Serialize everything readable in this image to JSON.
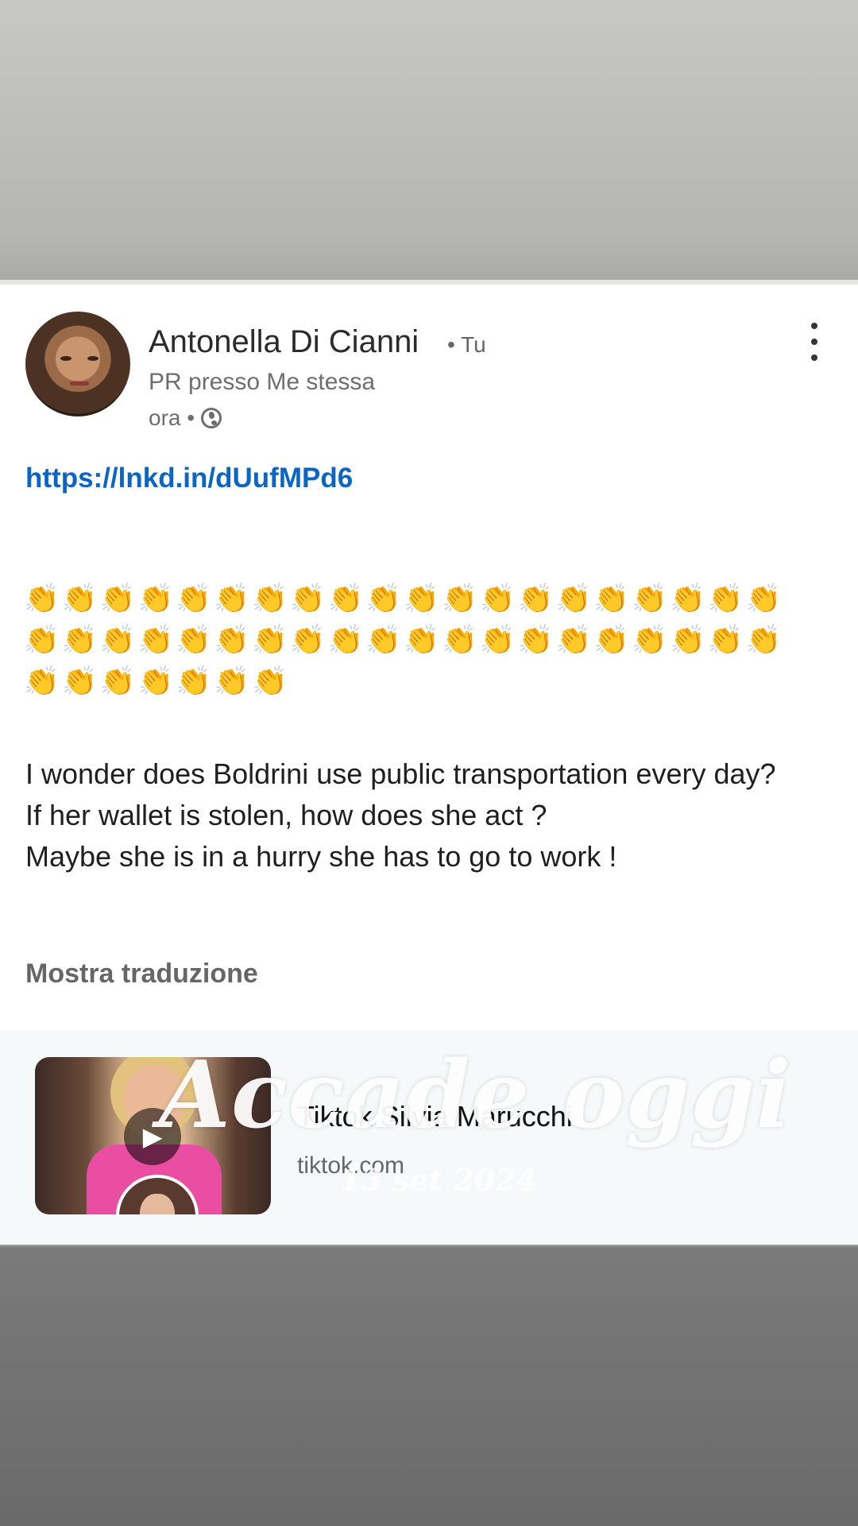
{
  "post": {
    "author": "Antonella Di Cianni",
    "author_suffix": "• Tu",
    "headline": "PR presso Me stessa",
    "timestamp": "ora •",
    "link": "https://lnkd.in/dUufMPd6",
    "clap_emojis": "👏👏👏👏👏👏👏👏👏👏👏👏👏👏👏👏👏👏👏👏👏👏👏👏👏👏👏👏👏👏👏👏👏👏👏👏👏👏👏👏👏👏👏👏👏👏👏",
    "lines": [
      "I wonder does Boldrini use public transportation every day?",
      "If her wallet is stolen, how does she act ?",
      "Maybe she is in a hurry she has to go to work !"
    ],
    "translate_label": "Mostra traduzione"
  },
  "preview": {
    "title": "Tiktok Silvia Marucchi",
    "domain": "tiktok.com"
  },
  "overlay": {
    "title": "Accade oggi",
    "date": "13 set 2024"
  },
  "icons": {
    "globe": "globe-icon",
    "menu": "more-vertical-icon",
    "play": "play-icon"
  },
  "colors": {
    "link": "#0a66c2",
    "card": "#ffffff",
    "preview_bg": "#f6f9fa"
  }
}
